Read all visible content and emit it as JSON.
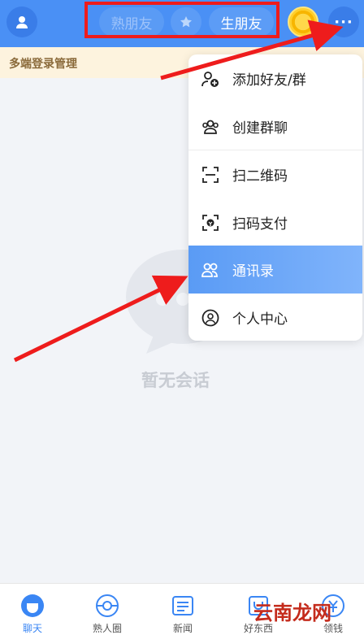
{
  "header": {
    "tab_left": "熟朋友",
    "tab_right": "生朋友",
    "more_label": "···"
  },
  "banner": {
    "text": "多端登录管理"
  },
  "empty_state": {
    "text": "暂无会话"
  },
  "menu": {
    "items": [
      {
        "label": "添加好友/群",
        "icon": "add-user-icon"
      },
      {
        "label": "创建群聊",
        "icon": "group-icon"
      },
      {
        "label": "扫二维码",
        "icon": "scan-icon"
      },
      {
        "label": "扫码支付",
        "icon": "scan-pay-icon"
      },
      {
        "label": "通讯录",
        "icon": "contacts-icon"
      },
      {
        "label": "个人中心",
        "icon": "profile-icon"
      }
    ]
  },
  "tabbar": {
    "items": [
      {
        "label": "聊天",
        "icon": "chat-icon"
      },
      {
        "label": "熟人圈",
        "icon": "circle-icon"
      },
      {
        "label": "新闻",
        "icon": "news-icon"
      },
      {
        "label": "好东西",
        "icon": "shop-icon"
      },
      {
        "label": "领钱",
        "icon": "money-icon"
      }
    ]
  },
  "watermark": "云南龙网",
  "colors": {
    "header": "#4a90f5",
    "accent": "#3a86f4",
    "highlight": "#ee1c1c"
  }
}
